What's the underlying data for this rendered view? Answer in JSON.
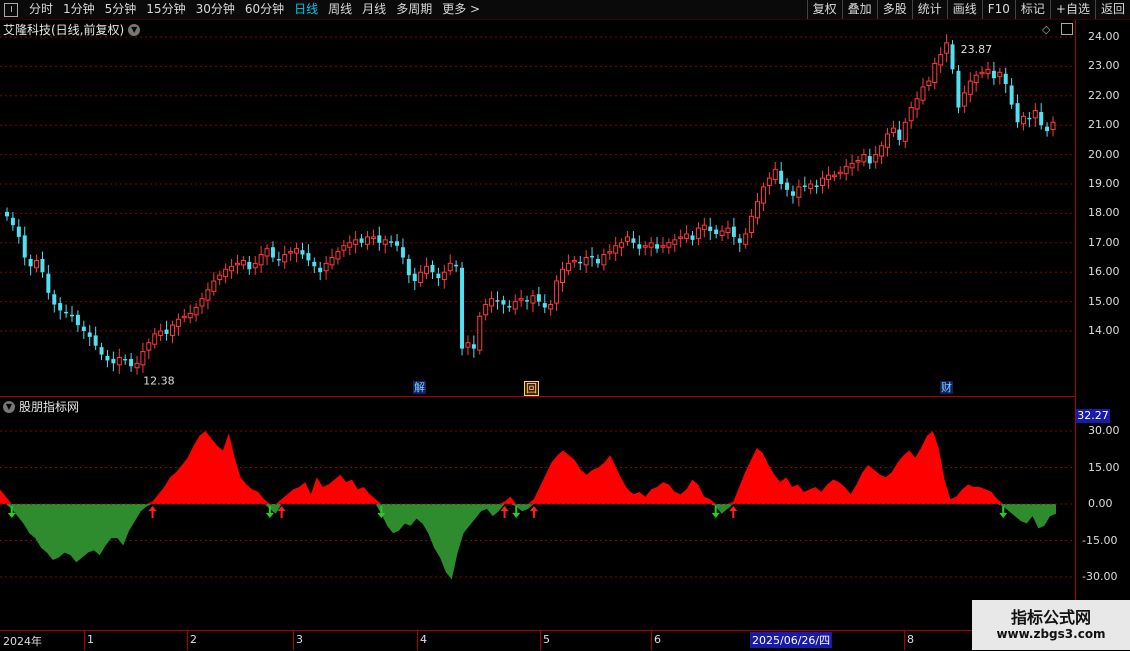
{
  "toolbar": {
    "periods": [
      "分时",
      "1分钟",
      "5分钟",
      "15分钟",
      "30分钟",
      "60分钟",
      "日线",
      "周线",
      "月线",
      "多周期",
      "更多 >"
    ],
    "active_period": "日线",
    "right_buttons": [
      "复权",
      "叠加",
      "多股",
      "统计",
      "画线",
      "F10",
      "标记",
      "+自选",
      "返回"
    ]
  },
  "stock_title": "艾隆科技(日线,前复权)",
  "indicator_title": "股朋指标网",
  "indicator_value": "32.27",
  "price_axis": [
    "24.00",
    "23.00",
    "22.00",
    "21.00",
    "20.00",
    "19.00",
    "18.00",
    "17.00",
    "16.00",
    "15.00",
    "14.00"
  ],
  "indicator_axis": [
    "30.00",
    "15.00",
    "0.00",
    "-15.00",
    "-30.00"
  ],
  "high_label": "23.87",
  "low_label": "12.38",
  "events": [
    "解",
    "回",
    "财"
  ],
  "date_axis": [
    "2024年",
    "1",
    "2",
    "3",
    "4",
    "5",
    "6",
    "7",
    "8"
  ],
  "date_highlight": "2025/06/26/四",
  "watermark": {
    "line1": "指标公式网",
    "line2": "www.zbgs3.com"
  },
  "colors": {
    "up": "#ff3b3b",
    "down": "#50e0f0",
    "pos_area": "#ff0000",
    "neg_area": "#2e8b2e",
    "grid": "#8b0000"
  },
  "chart_data": [
    {
      "type": "candlestick",
      "y_range": [
        13.2,
        24.4
      ],
      "high": 23.87,
      "low": 12.38,
      "closes": [
        17.9,
        17.6,
        17.2,
        16.5,
        16.2,
        16.4,
        16.0,
        15.3,
        14.9,
        14.7,
        14.6,
        14.5,
        14.2,
        14.0,
        13.8,
        13.5,
        13.2,
        13.0,
        12.9,
        13.1,
        13.0,
        12.8,
        12.9,
        13.3,
        13.6,
        13.9,
        14.0,
        13.9,
        14.2,
        14.4,
        14.5,
        14.6,
        14.8,
        15.1,
        15.4,
        15.7,
        15.9,
        16.1,
        16.2,
        16.3,
        16.4,
        16.1,
        16.3,
        16.6,
        16.8,
        16.5,
        16.4,
        16.6,
        16.7,
        16.8,
        16.6,
        16.4,
        16.2,
        16.0,
        16.3,
        16.5,
        16.7,
        16.9,
        17.0,
        17.1,
        17.0,
        17.2,
        17.2,
        17.0,
        17.1,
        17.0,
        16.9,
        16.5,
        15.9,
        15.7,
        16.0,
        16.2,
        16.0,
        15.8,
        16.0,
        16.3,
        16.2,
        13.4,
        13.6,
        13.4,
        14.5,
        14.9,
        15.1,
        15.0,
        14.9,
        14.8,
        15.0,
        15.1,
        15.0,
        15.2,
        15.0,
        14.8,
        14.9,
        15.7,
        16.1,
        16.3,
        16.4,
        16.3,
        16.5,
        16.5,
        16.3,
        16.6,
        16.7,
        16.9,
        17.0,
        17.2,
        17.0,
        16.8,
        16.9,
        17.0,
        16.8,
        16.9,
        17.0,
        17.1,
        17.2,
        17.3,
        17.1,
        17.5,
        17.6,
        17.4,
        17.3,
        17.4,
        17.5,
        17.2,
        17.0,
        17.3,
        17.9,
        18.4,
        18.9,
        19.2,
        19.5,
        19.0,
        18.8,
        18.6,
        18.9,
        18.9,
        19.0,
        18.9,
        19.2,
        19.3,
        19.3,
        19.4,
        19.6,
        19.7,
        19.8,
        20.0,
        19.7,
        20.0,
        20.3,
        20.7,
        20.9,
        20.5,
        21.1,
        21.6,
        21.9,
        22.3,
        22.5,
        23.1,
        23.4,
        23.8,
        22.9,
        21.6,
        22.1,
        22.5,
        22.7,
        22.8,
        22.9,
        22.6,
        22.8,
        22.4,
        21.7,
        21.1,
        21.3,
        21.2,
        21.5,
        21.0,
        20.8,
        21.1
      ]
    },
    {
      "type": "area",
      "name": "股朋指标网",
      "y_range": [
        -40,
        35
      ],
      "ticks": [
        30,
        15,
        0,
        -15,
        -30
      ],
      "values": [
        6,
        3,
        -2,
        -5,
        -8,
        -12,
        -14,
        -18,
        -20,
        -23,
        -22,
        -20,
        -21,
        -24,
        -22,
        -20,
        -19,
        -21,
        -17,
        -14,
        -14,
        -17,
        -11,
        -7,
        -3,
        -1,
        1,
        4,
        7,
        11,
        13,
        16,
        19,
        24,
        28,
        30,
        27,
        24,
        22,
        29,
        19,
        11,
        8,
        6,
        5,
        2,
        -2,
        -4,
        2,
        4,
        6,
        7,
        9,
        4,
        11,
        7,
        8,
        10,
        12,
        9,
        10,
        6,
        7,
        4,
        2,
        -4,
        -9,
        -12,
        -11,
        -8,
        -9,
        -6,
        -8,
        -12,
        -18,
        -22,
        -28,
        -31,
        -20,
        -12,
        -9,
        -6,
        -3,
        -2,
        -5,
        -3,
        1,
        3,
        -1,
        -3,
        -2,
        2,
        7,
        12,
        17,
        20,
        22,
        20,
        18,
        14,
        12,
        14,
        15,
        17,
        20,
        15,
        10,
        6,
        4,
        5,
        3,
        6,
        7,
        9,
        8,
        5,
        4,
        6,
        10,
        8,
        3,
        2,
        -1,
        -4,
        -2,
        1,
        7,
        13,
        18,
        23,
        21,
        16,
        12,
        9,
        11,
        7,
        8,
        5,
        6,
        7,
        5,
        8,
        10,
        9,
        7,
        4,
        8,
        13,
        16,
        14,
        12,
        11,
        13,
        17,
        20,
        22,
        19,
        23,
        28,
        30,
        23,
        10,
        2,
        3,
        6,
        8,
        7,
        7,
        6,
        5,
        2,
        -1,
        -3,
        -5,
        -7,
        -8,
        -5,
        -10,
        -9,
        -5,
        -4
      ]
    }
  ]
}
